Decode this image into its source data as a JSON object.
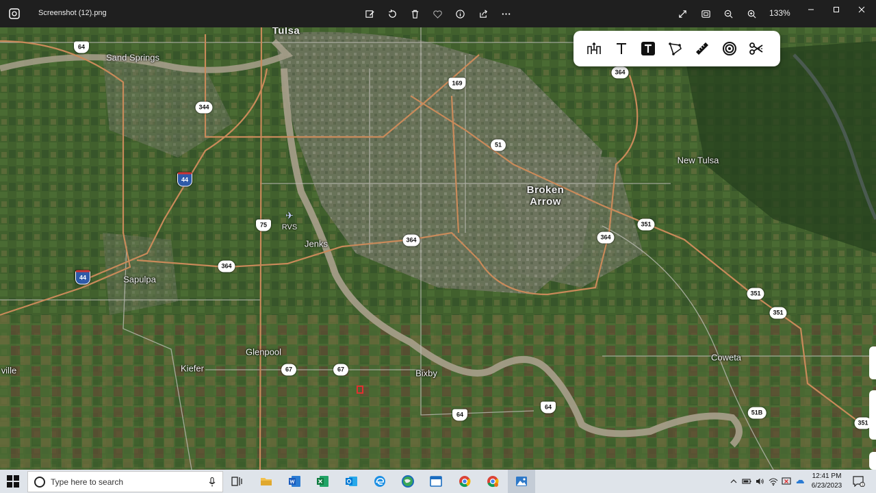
{
  "window": {
    "title": "Screenshot (12).png",
    "zoom": "133%"
  },
  "toolbar_icons": [
    "edit-image-icon",
    "rotate-icon",
    "delete-icon",
    "favorite-icon",
    "info-icon",
    "share-icon",
    "more-icon"
  ],
  "view_controls": [
    "fit-to-window-icon",
    "actual-size-icon",
    "zoom-out-icon",
    "zoom-in-icon"
  ],
  "markup_tools": [
    "road-sign-icon",
    "text-tool-icon",
    "text-box-tool-icon",
    "polygon-tool-icon",
    "measure-tool-icon",
    "circle-tool-icon",
    "scissors-tool-icon"
  ],
  "map": {
    "places": [
      {
        "name": "Tulsa",
        "size": "city"
      },
      {
        "name": "Sand Springs",
        "size": "town"
      },
      {
        "name": "New Tulsa",
        "size": "town"
      },
      {
        "name": "Broken Arrow",
        "size": "city"
      },
      {
        "name": "RVS",
        "size": "small"
      },
      {
        "name": "Jenks",
        "size": "town"
      },
      {
        "name": "Sapulpa",
        "size": "town"
      },
      {
        "name": "Glenpool",
        "size": "town"
      },
      {
        "name": "Kiefer",
        "size": "town"
      },
      {
        "name": "Bixby",
        "size": "town"
      },
      {
        "name": "Coweta",
        "size": "town"
      },
      {
        "name": "ville",
        "size": "town"
      }
    ],
    "route_shields": [
      {
        "label": "64",
        "type": "us"
      },
      {
        "label": "169",
        "type": "us"
      },
      {
        "label": "364",
        "type": "state"
      },
      {
        "label": "344",
        "type": "state"
      },
      {
        "label": "51",
        "type": "state"
      },
      {
        "label": "44",
        "type": "interstate"
      },
      {
        "label": "75",
        "type": "us"
      },
      {
        "label": "351",
        "type": "state"
      },
      {
        "label": "364",
        "type": "state"
      },
      {
        "label": "364",
        "type": "state"
      },
      {
        "label": "364",
        "type": "state"
      },
      {
        "label": "44",
        "type": "interstate"
      },
      {
        "label": "351",
        "type": "state"
      },
      {
        "label": "351",
        "type": "state"
      },
      {
        "label": "67",
        "type": "state"
      },
      {
        "label": "67",
        "type": "state"
      },
      {
        "label": "64",
        "type": "us"
      },
      {
        "label": "64",
        "type": "us"
      },
      {
        "label": "51B",
        "type": "state"
      },
      {
        "label": "351",
        "type": "state"
      }
    ]
  },
  "taskbar": {
    "search_placeholder": "Type here to search",
    "apps": [
      "task-view-icon",
      "file-explorer-icon",
      "word-icon",
      "excel-icon",
      "outlook-icon",
      "edge-icon",
      "browser-globe-icon",
      "window-app-icon",
      "chrome-icon",
      "chrome-alt-icon",
      "photos-icon"
    ],
    "time": "12:41 PM",
    "date": "6/23/2023"
  },
  "colors": {
    "titlebar": "#1f1f1f",
    "taskbar": "#dfe4ea",
    "road": "#c98a5a",
    "river": "#a8a08c"
  }
}
